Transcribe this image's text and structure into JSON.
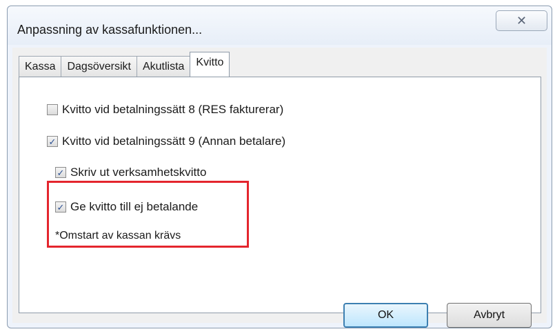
{
  "window": {
    "title": "Anpassning av kassafunktionen...",
    "close_symbol": "☒"
  },
  "tabs": [
    {
      "label": "Kassa",
      "active": false
    },
    {
      "label": "Dagsöversikt",
      "active": false
    },
    {
      "label": "Akutlista",
      "active": false
    },
    {
      "label": "Kvitto",
      "active": true
    }
  ],
  "options": [
    {
      "label": "Kvitto vid betalningssätt 8 (RES fakturerar)",
      "checked": false
    },
    {
      "label": "Kvitto vid betalningssätt 9 (Annan betalare)",
      "checked": true
    },
    {
      "label": "Skriv ut verksamhetskvitto",
      "checked": true
    },
    {
      "label": "Ge kvitto till ej betalande",
      "checked": true
    }
  ],
  "note": "*Omstart av kassan krävs",
  "buttons": {
    "ok": "OK",
    "cancel": "Avbryt"
  },
  "colors": {
    "highlight": "#e4252d",
    "check": "#2a4f92"
  }
}
